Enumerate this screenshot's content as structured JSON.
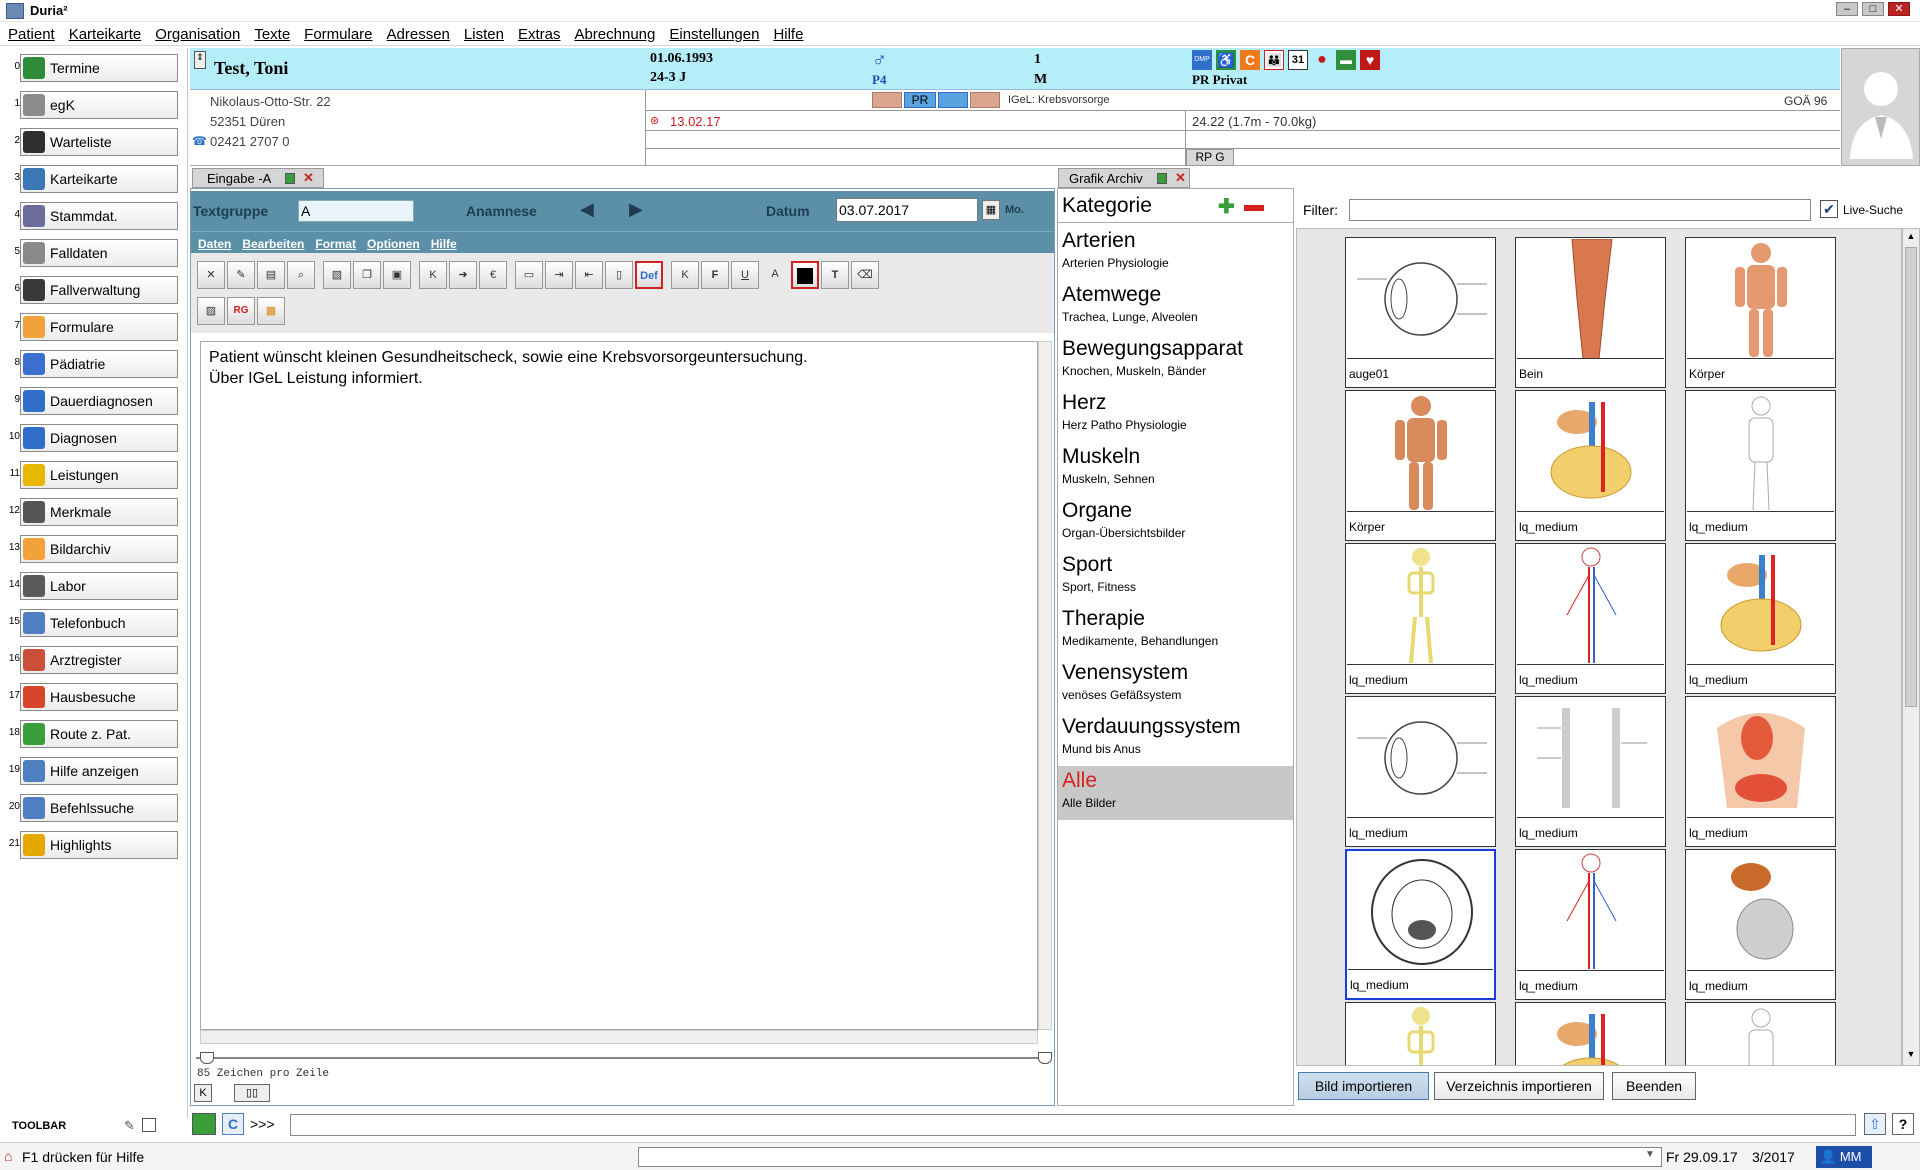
{
  "window": {
    "title": "Duria²"
  },
  "menu": [
    "Patient",
    "Karteikarte",
    "Organisation",
    "Texte",
    "Formulare",
    "Adressen",
    "Listen",
    "Extras",
    "Abrechnung",
    "Einstellungen",
    "Hilfe"
  ],
  "nav": [
    {
      "num": "0",
      "label": "Termine",
      "color": "#2e8b3a"
    },
    {
      "num": "1",
      "label": "egK",
      "color": "#8c8c8c"
    },
    {
      "num": "2",
      "label": "Warteliste",
      "color": "#2f2f2f"
    },
    {
      "num": "3",
      "label": "Karteikarte",
      "color": "#3c77b5"
    },
    {
      "num": "4",
      "label": "Stammdat.",
      "color": "#6b6b9c"
    },
    {
      "num": "5",
      "label": "Falldaten",
      "color": "#8a8a8a"
    },
    {
      "num": "6",
      "label": "Fallverwaltung",
      "color": "#3a3a3a"
    },
    {
      "num": "7",
      "label": "Formulare",
      "color": "#f2a23a"
    },
    {
      "num": "8",
      "label": "Pädiatrie",
      "color": "#3a6fd0"
    },
    {
      "num": "9",
      "label": "Dauerdiagnosen",
      "color": "#2f6fc9"
    },
    {
      "num": "10",
      "label": "Diagnosen",
      "color": "#2f6fc9"
    },
    {
      "num": "11",
      "label": "Leistungen",
      "color": "#e6b800"
    },
    {
      "num": "12",
      "label": "Merkmale",
      "color": "#555555"
    },
    {
      "num": "13",
      "label": "Bildarchiv",
      "color": "#f2a23a"
    },
    {
      "num": "14",
      "label": "Labor",
      "color": "#5a5a5a"
    },
    {
      "num": "15",
      "label": "Telefonbuch",
      "color": "#4f7fc0"
    },
    {
      "num": "16",
      "label": "Arztregister",
      "color": "#c94f3a"
    },
    {
      "num": "17",
      "label": "Hausbesuche",
      "color": "#d9452b"
    },
    {
      "num": "18",
      "label": "Route z. Pat.",
      "color": "#3a9e3a"
    },
    {
      "num": "19",
      "label": "Hilfe anzeigen",
      "color": "#4f7fc0"
    },
    {
      "num": "20",
      "label": "Befehlssuche",
      "color": "#4f7fc0"
    },
    {
      "num": "21",
      "label": "Highlights",
      "color": "#e6a800"
    }
  ],
  "toolbar_label": "TOOLBAR",
  "patient": {
    "name": "Test, Toni",
    "dob": "01.06.1993",
    "age": "24-3 J",
    "p_code": "P4",
    "num": "1",
    "sex": "M",
    "insurance": "PR Privat",
    "street": "Nikolaus-Otto-Str. 22",
    "city": "52351 Düren",
    "phone": "02421 2707 0",
    "tab_pr": "PR",
    "igel": "IGeL: Krebsvorsorge",
    "goa": "GOÄ 96",
    "visit_date": "13.02.17",
    "bmi": "24.22   (1.7m - 70.0kg)",
    "rpg": "RP G",
    "badge_31": "31",
    "badge_c": "C",
    "badge_dmp": "DMP"
  },
  "eingabe": {
    "tab": "Eingabe -A",
    "textgruppe_label": "Textgruppe",
    "textgruppe_value": "A",
    "anamnese": "Anamnese",
    "datum_label": "Datum",
    "datum_value": "03.07.2017",
    "weekday": "Mo.",
    "submenu": [
      "Daten",
      "Bearbeiten",
      "Format",
      "Optionen",
      "Hilfe"
    ],
    "text_line1": "Patient wünscht kleinen Gesundheitscheck, sowie eine Krebsvorsorgeuntersuchung.",
    "text_line2": "Über IGeL Leistung informiert.",
    "zeichen": "85 Zeichen pro Zeile",
    "tb_def": "Def",
    "tb_a": "A",
    "tb_t": "T",
    "tb_k": "K",
    "tb_f": "F",
    "tb_u": "U",
    "tb_euro": "€",
    "tb_rg": "RG"
  },
  "grafik": {
    "tab": "Grafik Archiv",
    "kategorie_label": "Kategorie",
    "filter_label": "Filter:",
    "live_suche": "Live-Suche",
    "categories": [
      {
        "name": "Arterien",
        "desc": "Arterien Physiologie"
      },
      {
        "name": "Atemwege",
        "desc": "Trachea, Lunge, Alveolen"
      },
      {
        "name": "Bewegungsapparat",
        "desc": "Knochen, Muskeln, Bänder"
      },
      {
        "name": "Herz",
        "desc": "Herz Patho Physiologie"
      },
      {
        "name": "Muskeln",
        "desc": "Muskeln, Sehnen"
      },
      {
        "name": "Organe",
        "desc": "Organ-Übersichtsbilder"
      },
      {
        "name": "Sport",
        "desc": "Sport, Fitness"
      },
      {
        "name": "Therapie",
        "desc": "Medikamente, Behandlungen"
      },
      {
        "name": "Venensystem",
        "desc": "venöses Gefäßsystem"
      },
      {
        "name": "Verdauungssystem",
        "desc": "Mund bis Anus"
      },
      {
        "name": "Alle",
        "desc": "Alle Bilder"
      }
    ],
    "thumbs": [
      "auge01",
      "Bein",
      "Körper",
      "Körper",
      "lq_medium",
      "lq_medium",
      "lq_medium",
      "lq_medium",
      "lq_medium",
      "lq_medium",
      "lq_medium",
      "lq_medium",
      "lq_medium",
      "lq_medium",
      "lq_medium"
    ],
    "btn_bild": "Bild importieren",
    "btn_verz": "Verzeichnis importieren",
    "btn_beenden": "Beenden"
  },
  "cmd": {
    "prompt": ">>>"
  },
  "status": {
    "help": "F1 drücken für Hilfe",
    "date": "Fr 29.09.17",
    "quarter": "3/2017",
    "user": "MM"
  }
}
